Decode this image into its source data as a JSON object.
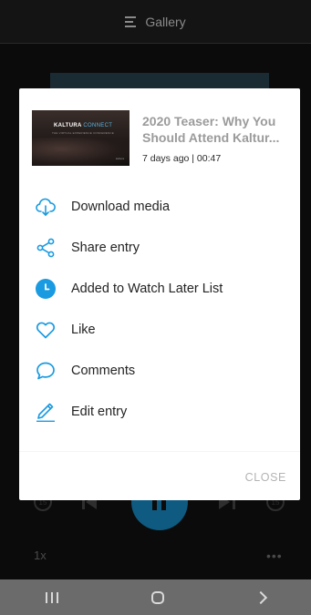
{
  "topbar": {
    "title": "Gallery"
  },
  "player": {
    "skip_back_label": "15",
    "skip_forward_label": "15",
    "speed": "1x",
    "more": "•••"
  },
  "sheet": {
    "media": {
      "title": "2020 Teaser: Why You Should Attend Kaltur...",
      "meta": "7 days ago | 00:47",
      "thumb_brand": "KALTURA",
      "thumb_brand_suffix": "CONNECT",
      "thumb_sub": "THE VIRTUAL EXPERIENCE CONFERENCE",
      "thumb_corner": "kaltura"
    },
    "items": [
      {
        "label": "Download media",
        "icon": "cloud-download-icon"
      },
      {
        "label": "Share entry",
        "icon": "share-icon"
      },
      {
        "label": "Added to Watch Later List",
        "icon": "clock-icon"
      },
      {
        "label": "Like",
        "icon": "heart-icon"
      },
      {
        "label": "Comments",
        "icon": "comment-icon"
      },
      {
        "label": "Edit entry",
        "icon": "pencil-icon"
      }
    ],
    "close_label": "CLOSE"
  },
  "colors": {
    "accent": "#1a9ae0",
    "play_button": "#0f5a80",
    "nav_bar": "#6b6b6b"
  }
}
